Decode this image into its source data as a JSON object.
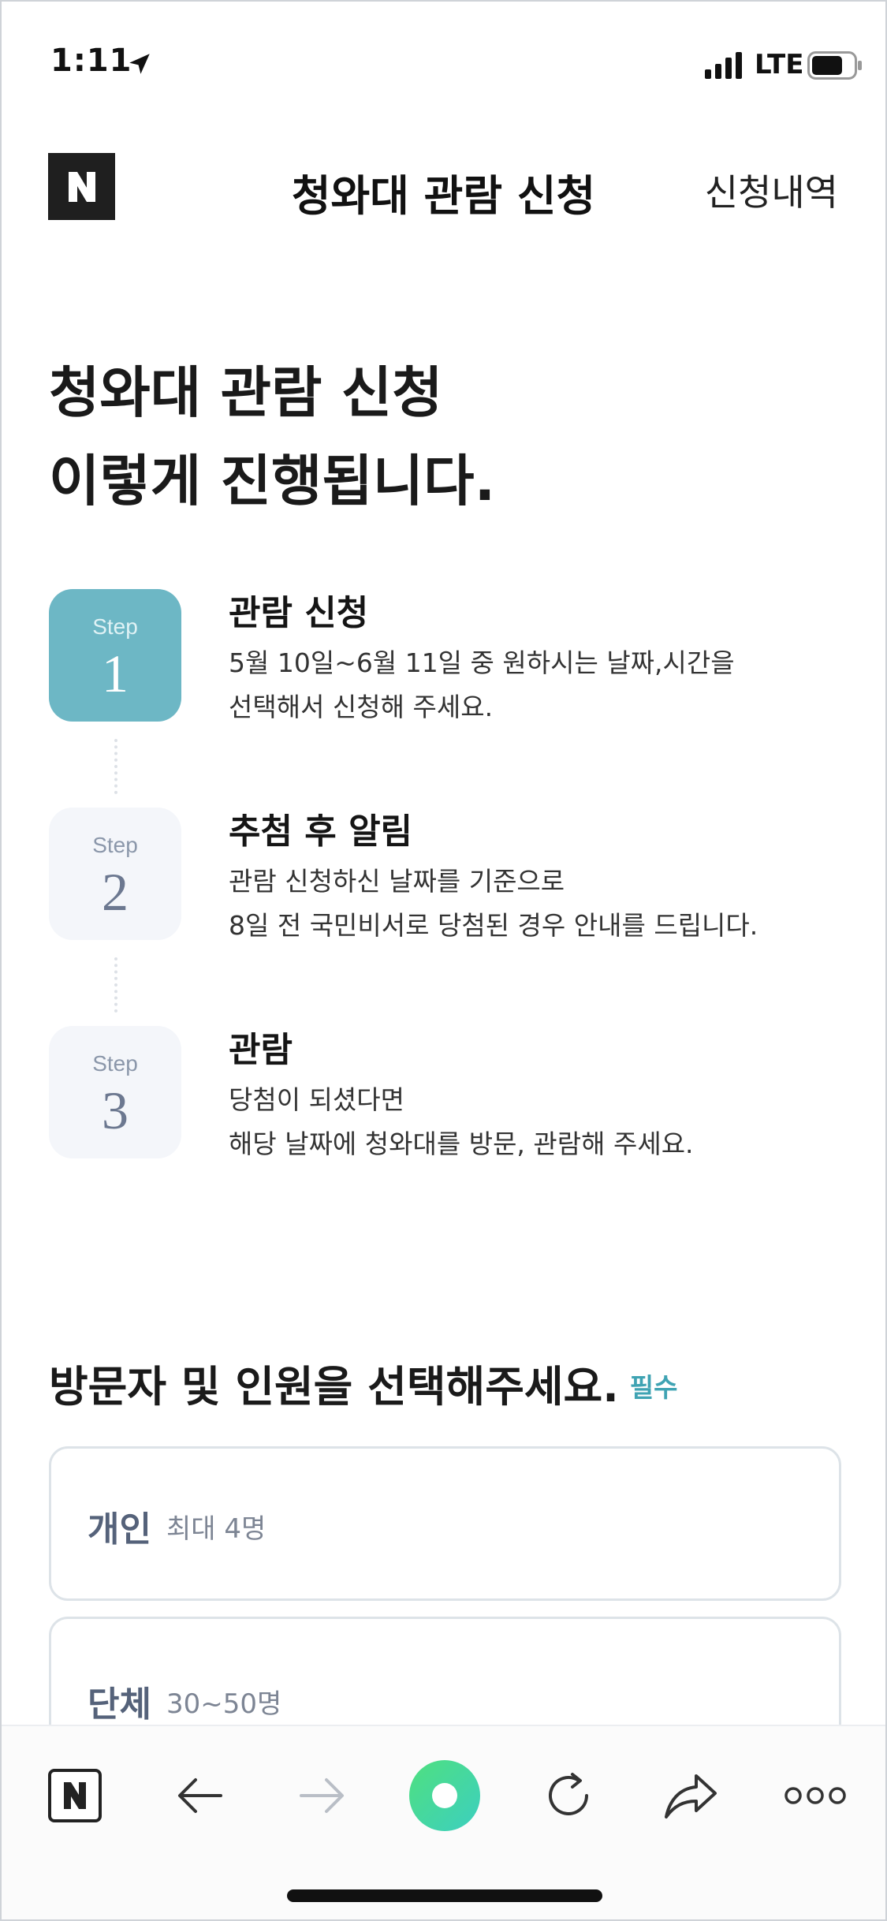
{
  "status_bar": {
    "time": "1:11",
    "network": "LTE"
  },
  "header": {
    "logo": "N",
    "title": "청와대 관람 신청",
    "history_link": "신청내역"
  },
  "intro": {
    "line1": "청와대 관람 신청",
    "line2": "이렇게 진행됩니다."
  },
  "steps": [
    {
      "label": "Step",
      "number": "1",
      "title": "관람 신청",
      "desc1": "5월 10일~6월 11일 중 원하시는 날짜,시간을",
      "desc2": "선택해서 신청해 주세요.",
      "active": true
    },
    {
      "label": "Step",
      "number": "2",
      "title": "추첨 후 알림",
      "desc1": "관람 신청하신 날짜를 기준으로",
      "desc2": "8일 전 국민비서로 당첨된 경우 안내를 드립니다.",
      "active": false
    },
    {
      "label": "Step",
      "number": "3",
      "title": "관람",
      "desc1": "당첨이 되셨다면",
      "desc2": "해당 날짜에 청와대를 방문, 관람해 주세요.",
      "active": false
    }
  ],
  "visitor_section": {
    "title": "방문자 및 인원을 선택해주세요.",
    "required": "필수",
    "options": [
      {
        "label": "개인",
        "sub": "최대 4명"
      },
      {
        "label": "단체",
        "sub": "30~50명"
      }
    ]
  },
  "toolbar": {
    "logo": "N",
    "icons": [
      "naver-home-icon",
      "back-arrow-icon",
      "forward-arrow-icon",
      "green-dot-icon",
      "refresh-icon",
      "share-icon",
      "more-icon"
    ]
  },
  "colors": {
    "step_active": "#6db7c5",
    "required": "#3fa3b3",
    "green_dot": "#3dd68c"
  }
}
